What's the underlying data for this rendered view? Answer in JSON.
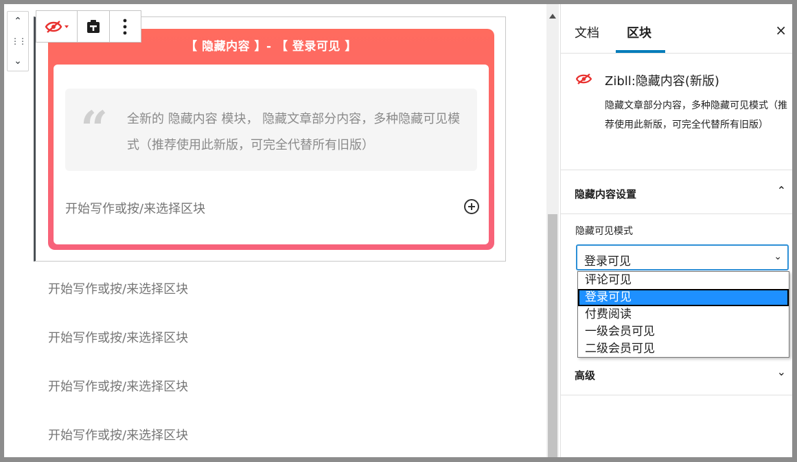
{
  "editor": {
    "block_title": "【 隐藏内容 】- 【 登录可见 】",
    "quote_text": "全新的 隐藏内容 模块， 隐藏文章部分内容，多种隐藏可见模式（推荐使用此新版，可完全代替所有旧版）",
    "inner_placeholder": "开始写作或按/来选择区块",
    "paragraphs": [
      "开始写作或按/来选择区块",
      "开始写作或按/来选择区块",
      "开始写作或按/来选择区块",
      "开始写作或按/来选择区块"
    ]
  },
  "sidebar": {
    "tabs": [
      "文档",
      "区块"
    ],
    "active_tab": "区块",
    "close": "×",
    "block_card": {
      "title": "Zibll:隐藏内容(新版)",
      "description": "隐藏文章部分内容，多种隐藏可见模式（推荐使用此新版，可完全代替所有旧版）",
      "icon": "eye-slash-icon"
    },
    "settings_panel": {
      "title": "隐藏内容设置",
      "field_label": "隐藏可见模式",
      "selected_value": "登录可见",
      "options": [
        "评论可见",
        "登录可见",
        "付费阅读",
        "一级会员可见",
        "二级会员可见"
      ]
    },
    "advanced_panel": {
      "title": "高级"
    }
  },
  "colors": {
    "accent": "#007cba",
    "block_gradient_top": "#ff6b5e",
    "block_gradient_bottom": "#f7627a",
    "eye_icon": "#e8312f"
  }
}
